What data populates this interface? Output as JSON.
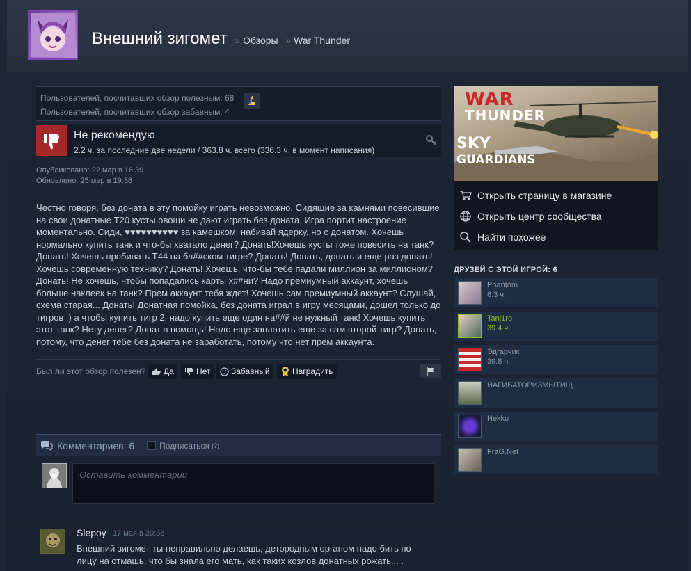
{
  "header": {
    "user_name": "Внешний зигомет",
    "breadcrumb_sep": "»",
    "crumbs": [
      "Обзоры",
      "War Thunder"
    ]
  },
  "review": {
    "votes_helpful": "Пользователей, посчитавших обзор полезным: 68",
    "votes_funny": "Пользователей, посчитавших обзор забавным: 4",
    "recommendation": "Не рекомендую",
    "hours": "2.2 ч. за последние две недели / 363.8 ч. всего (336.3 ч. в момент написания)",
    "published": "Опубликовано: 22 мар в 16:39",
    "updated": "Обновлено: 25 мар в 19:38",
    "text": "Честно говоря, без доната в эту помойку играть невозможно. Сидящие за камнями повесившие на свои донатные Т20 кусты овощи не дают играть без доната. Игра портит настроение моментально. Сиди, ♥♥♥♥♥♥♥♥♥♥ за камешком, набивай ядерку, но с донатом. Хочешь нормально купить танк и что-бы хватало денег? Донать!Хочешь кусты тоже повесить на танк? Донать! Хочешь пробивать Т44 на бл##ском тигре? Донать! Донать, донать и еще раз донать! Хочешь современную технику? Донать! Хочешь, что-бы тебе падали миллион за миллионом? Донать! Не хочешь, чтобы попадались карты х##ни? Надо премиумный аккаунт, хочешь больше наклеек на танк? Прем аккаунт тебя ждет! Хочешь сам премиумный аккаунт? Слушай, схема старая... Донать! Донатная помойка, без доната играл в игру месяцами, дошел только до тигров :) а чтобы купить тигр 2, надо купить еще один на##й не нужный танк! Хочешь купить этот танк? Нету денег? Донат в помощь! Надо еще заплатить еще за сам второй тигр? Донать, потому, что денег тебе без доната не заработать, потому что нет прем аккаунта."
  },
  "helpful": {
    "question": "Был ли этот обзор полезен?",
    "yes": "Да",
    "no": "Нет",
    "funny": "Забавный",
    "award": "Наградить"
  },
  "comments": {
    "count_label": "Комментариев: 6",
    "subscribe": "Подписаться",
    "help_mark": "(?)",
    "placeholder": "Оставить комментарий",
    "items": [
      {
        "author": "Slepoy",
        "time": "17 мая в 20:38",
        "text": "Внешний зигомет ты неправильно делаешь, детородным органом надо бить по лицу на отмашь, что бы знала его мать, как таких козлов донатных рожать... ."
      }
    ]
  },
  "game": {
    "banner_line1": "WAR",
    "banner_line2": "THUNDER",
    "banner_line3": "SKY",
    "banner_line4": "GUARDIANS",
    "links": [
      "Открыть страницу в магазине",
      "Открыть центр сообщества",
      "Найти похожее"
    ]
  },
  "friends": {
    "title": "ДРУЗЕЙ С ЭТОЙ ИГРОЙ: 6",
    "items": [
      {
        "name": "Phañţõm",
        "hours": "6.3 ч."
      },
      {
        "name": "Tanj1ro",
        "hours": "39.4 ч."
      },
      {
        "name": "Эдгарчик",
        "hours": "39.8 ч."
      },
      {
        "name": "НАГИБАТОРИЗМЫТИЩ",
        "hours": ""
      },
      {
        "name": "Hekko",
        "hours": ""
      },
      {
        "name": "FraG.Net",
        "hours": ""
      }
    ]
  },
  "colors": {
    "thumb_down_bg": "#a5282b",
    "online_green": "#90ba3c",
    "panel_bg": "#1f2d42"
  }
}
